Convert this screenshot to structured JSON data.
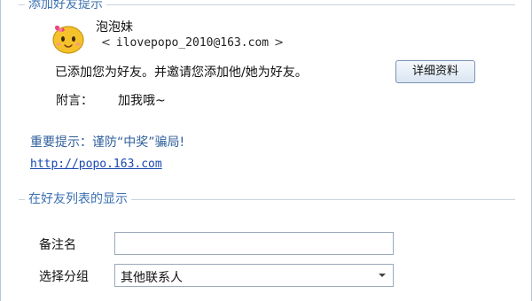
{
  "sections": {
    "add_friend_notice": "添加好友提示",
    "friend_list_display": "在好友列表的显示"
  },
  "user": {
    "nickname": "泡泡妹",
    "email": "ilovepopo_2010@163.com",
    "avatar_icon": "smiley-face-icon"
  },
  "message": "已添加您为好友。并邀请您添加他/她为好友。",
  "note": {
    "label": "附言：",
    "text": "加我哦~"
  },
  "buttons": {
    "details": "详细资料"
  },
  "warning": "重要提示：谨防“中奖”骗局!",
  "link": "http://popo.163.com",
  "form": {
    "remark_label": "备注名",
    "remark_value": "",
    "group_label": "选择分组",
    "group_selected": "其他联系人"
  },
  "colors": {
    "section_title": "#3a6fb0",
    "link": "#1a47b0",
    "avatar": "#f6c22b"
  }
}
